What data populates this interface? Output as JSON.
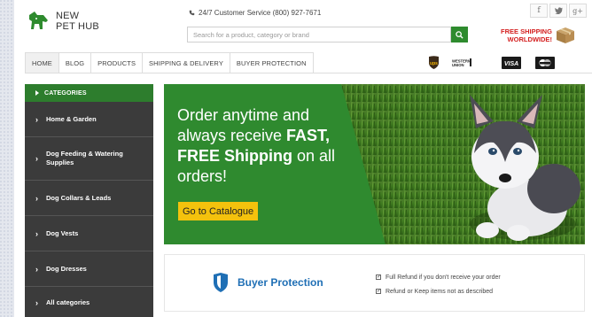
{
  "header": {
    "logo_line1": "NEW",
    "logo_line2": "PET HUB",
    "customer_service": "24/7 Customer Service (800) 927-7671",
    "search_placeholder": "Search for a product, category or brand",
    "shipping_line1": "FREE SHIPPING",
    "shipping_line2": "WORLDWIDE!",
    "social": [
      "f",
      "𝐭",
      "g+"
    ]
  },
  "nav": {
    "items": [
      "HOME",
      "BLOG",
      "PRODUCTS",
      "SHIPPING & DELIVERY",
      "BUYER PROTECTION"
    ],
    "payments": [
      "UPS",
      "WESTERN UNION",
      "VISA",
      "MasterCard"
    ]
  },
  "sidebar": {
    "title": "CATEGORIES",
    "items": [
      "Home & Garden",
      "Dog Feeding & Watering Supplies",
      "Dog Collars & Leads",
      "Dog Vests",
      "Dog Dresses",
      "All categories"
    ]
  },
  "banner": {
    "line1": "Order anytime and",
    "line2_pre": "always receive ",
    "line2_bold": "FAST,",
    "line3_bold": "FREE Shipping",
    "line3_post": " on all",
    "line4": "orders!",
    "cta": "Go to Catalogue"
  },
  "buyer_protection": {
    "title": "Buyer Protection",
    "points": [
      "Full Refund if you don't receive your order",
      "Refund or Keep items not as described"
    ]
  },
  "colors": {
    "brand_green": "#2e8b2e",
    "sidebar_bg": "#3b3b3b",
    "cta_yellow": "#f4c20d",
    "bp_blue": "#1f6fb5",
    "shipping_red": "#d42020"
  }
}
